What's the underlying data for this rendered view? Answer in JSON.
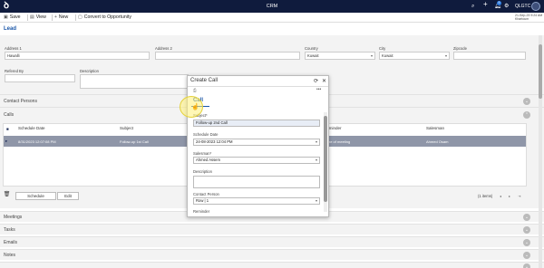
{
  "topbar": {
    "app_title": "CRM",
    "company": "QLGTC",
    "notification_count": "9",
    "colors": {
      "background": "#0f1b3d"
    }
  },
  "toolbar": {
    "save_label": "Save",
    "view_label": "View",
    "new_label": "New",
    "convert_label": "Convert to Opportunity",
    "datetime_line1": "21-Sep-23 9:24 AM",
    "datetime_line2": "Khartoum"
  },
  "page": {
    "title": "Lead"
  },
  "form": {
    "address1_label": "Address 1",
    "address1_value": "Hawalli",
    "address2_label": "Address 2",
    "address2_value": "",
    "country_label": "Country",
    "country_value": "Kuwait",
    "city_label": "City",
    "city_value": "Kuwait",
    "zipcode_label": "Zipcode",
    "zipcode_value": "",
    "referred_by_label": "Refered By",
    "description_label": "Description"
  },
  "sections": {
    "contact_persons": "Contact Persons",
    "calls": "Calls",
    "meetings": "Meetings",
    "tasks": "Tasks",
    "emails": "Emails",
    "notes": "Notes"
  },
  "calls_table": {
    "columns": [
      "Schedule Date",
      "Subject",
      "Reminder",
      "Salesman"
    ],
    "rows": [
      {
        "schedule_date": "8/31/2023 12:07:08 PM",
        "subject": "Follow-up 1st Call",
        "reminder": "ne of meeting",
        "salesman": "Ahmed Osam"
      }
    ],
    "footer": {
      "schedule_label": "Schedule",
      "edit_label": "Edit",
      "items_count": "(1 items)"
    }
  },
  "modal": {
    "title": "Create Call",
    "tab_label": "Call",
    "subject_label": "Subject*",
    "subject_value": "Follow-up 2nd Call",
    "schedule_date_label": "Schedule Date",
    "schedule_date_value": "24-08-2023 12:04 PM",
    "salesman_label": "Salesman*",
    "salesman_value": "Ahmed Assem",
    "description_label": "Description",
    "description_value": "",
    "contact_person_label": "Contact Person",
    "contact_person_value": "Row | 1",
    "reminder_label": "Reminder"
  }
}
